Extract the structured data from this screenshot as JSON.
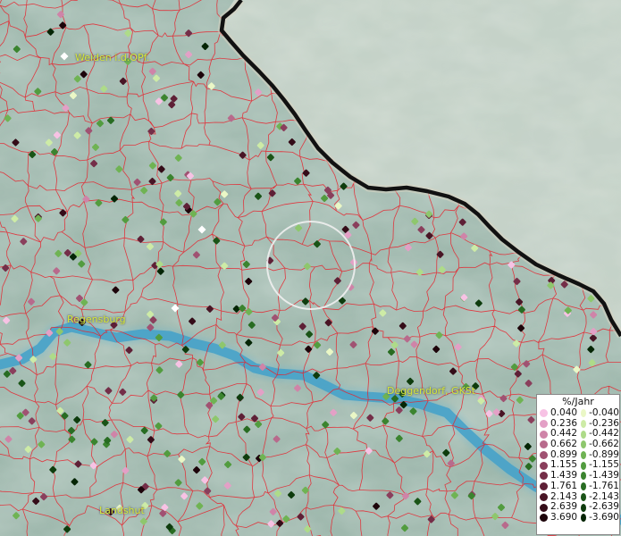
{
  "map": {
    "cities": [
      {
        "name": "Weiden i.d.OPf.",
        "key": "weiden"
      },
      {
        "name": "Regensburg",
        "key": "regensburg"
      },
      {
        "name": "Deggendorf, GKSt",
        "key": "deggendorf"
      },
      {
        "name": "Landshut",
        "key": "landshut"
      }
    ],
    "colors": {
      "terrain_base": "#9fb8ad",
      "terrain_high": "#c9d4c8",
      "river": "#3f9bc4",
      "boundary": "#e8202a",
      "border": "#111111",
      "marker_circle": "#f0f0f0",
      "city_label": "#d6e83a"
    }
  },
  "legend": {
    "title": "%/Jahr",
    "positive": [
      {
        "label": "0.040",
        "color": "#f7c2e4"
      },
      {
        "label": "0.236",
        "color": "#e3a0c6"
      },
      {
        "label": "0.442",
        "color": "#cf84a8"
      },
      {
        "label": "0.662",
        "color": "#b86a8c"
      },
      {
        "label": "0.899",
        "color": "#a05272"
      },
      {
        "label": "1.155",
        "color": "#8a3f5c"
      },
      {
        "label": "1.439",
        "color": "#742e48"
      },
      {
        "label": "1.761",
        "color": "#5e2036"
      },
      {
        "label": "2.143",
        "color": "#491525"
      },
      {
        "label": "2.639",
        "color": "#340c18"
      },
      {
        "label": "3.690",
        "color": "#1d040a"
      }
    ],
    "negative": [
      {
        "label": "-0.040",
        "color": "#eaf7c6"
      },
      {
        "label": "-0.236",
        "color": "#cdeba6"
      },
      {
        "label": "-0.442",
        "color": "#aedb89"
      },
      {
        "label": "-0.662",
        "color": "#8ec76d"
      },
      {
        "label": "-0.899",
        "color": "#6fb353"
      },
      {
        "label": "-1.155",
        "color": "#529c3f"
      },
      {
        "label": "-1.439",
        "color": "#3b842f"
      },
      {
        "label": "-1.761",
        "color": "#286c22"
      },
      {
        "label": "-2.143",
        "color": "#1a5417"
      },
      {
        "label": "-2.639",
        "color": "#0e3c0d"
      },
      {
        "label": "-3.690",
        "color": "#052505"
      }
    ]
  }
}
